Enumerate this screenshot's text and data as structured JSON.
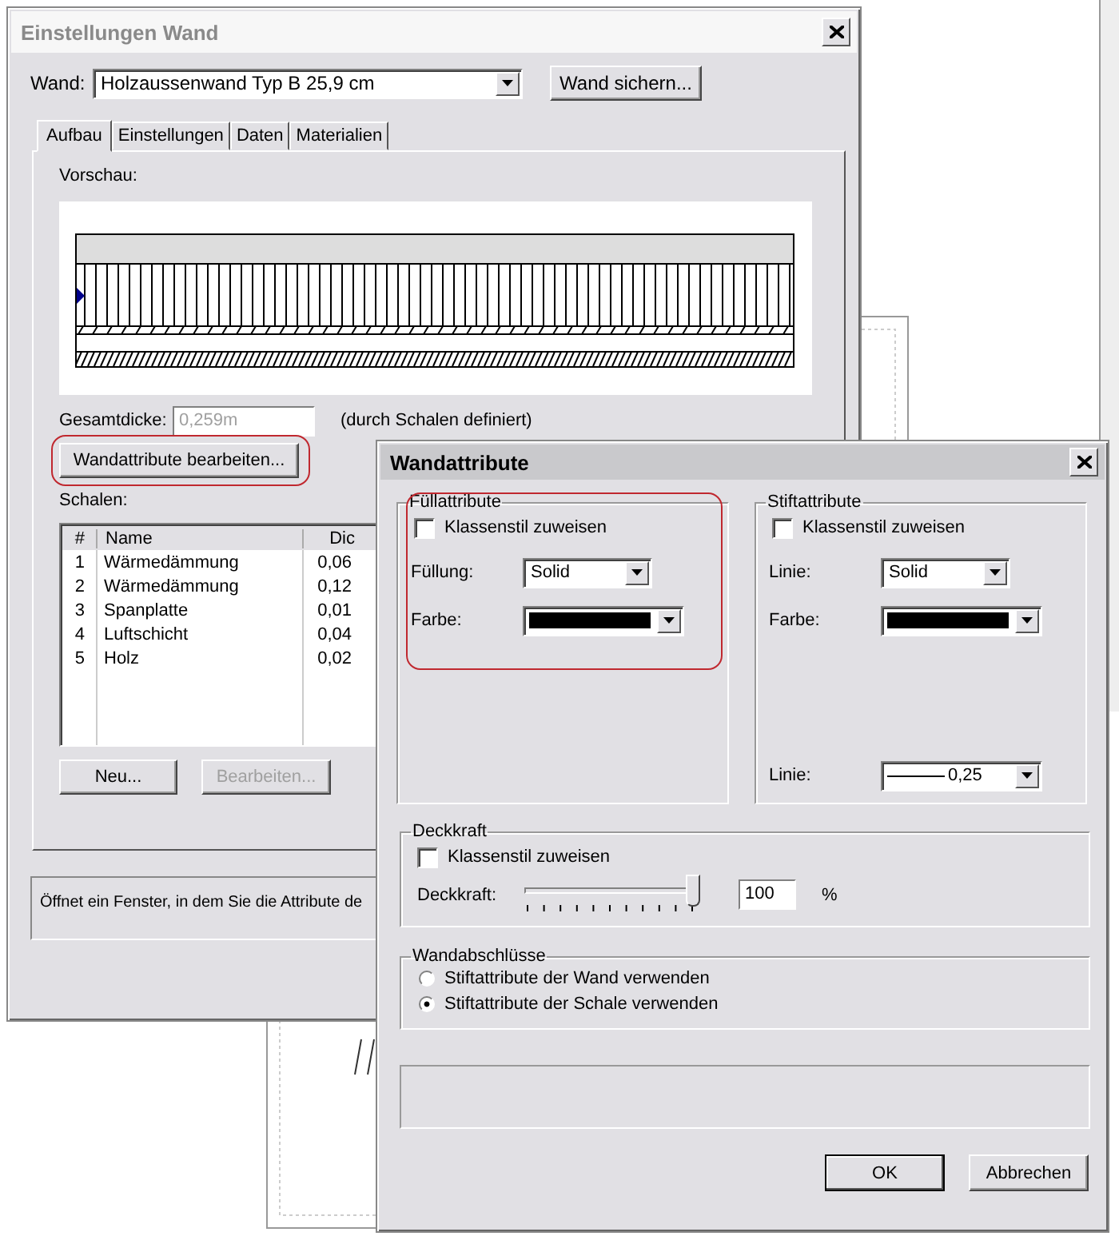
{
  "settings_window": {
    "title": "Einstellungen Wand",
    "active": false,
    "wall_label": "Wand:",
    "wall_value": "Holzaussenwand Typ B 25,9 cm",
    "save_button": "Wand sichern...",
    "tabs": [
      {
        "label": "Aufbau",
        "selected": true
      },
      {
        "label": "Einstellungen",
        "selected": false
      },
      {
        "label": "Daten",
        "selected": false
      },
      {
        "label": "Materialien",
        "selected": false
      }
    ],
    "preview_label": "Vorschau:",
    "thickness_label": "Gesamtdicke:",
    "thickness_value": "0,259m",
    "thickness_disabled": true,
    "thickness_note": "(durch Schalen definiert)",
    "edit_button": {
      "label": "Wandattribute bearbeiten...",
      "highlighted": true
    },
    "layers_label": "Schalen:",
    "layers": {
      "columns": [
        "#",
        "Name",
        "Dic"
      ],
      "rows": [
        [
          "1",
          "Wärmedämmung",
          "0,06"
        ],
        [
          "2",
          "Wärmedämmung",
          "0,12"
        ],
        [
          "3",
          "Spanplatte",
          "0,01"
        ],
        [
          "4",
          "Luftschicht",
          "0,04"
        ],
        [
          "5",
          "Holz",
          "0,02"
        ]
      ]
    },
    "buttons": [
      {
        "label": "Neu...",
        "disabled": false
      },
      {
        "label": "Bearbeiten...",
        "disabled": true
      }
    ],
    "status": "Öffnet ein Fenster, in dem Sie die Attribute de"
  },
  "attributes_window": {
    "title": "Wandattribute",
    "active": true,
    "groups": [
      {
        "title": "Füllattribute",
        "highlighted": true,
        "class_style": {
          "label": "Klassenstil zuweisen",
          "checked": false
        },
        "fields": [
          {
            "label": "Füllung:",
            "kind": "select",
            "value": "Solid"
          },
          {
            "label": "Farbe:",
            "kind": "color",
            "color": "#000000"
          }
        ]
      },
      {
        "title": "Stiftattribute",
        "highlighted": false,
        "class_style": {
          "label": "Klassenstil zuweisen",
          "checked": false
        },
        "fields": [
          {
            "label": "Linie:",
            "kind": "select",
            "value": "Solid"
          },
          {
            "label": "Farbe:",
            "kind": "color",
            "color": "#000000"
          },
          {
            "label": "Linie:",
            "kind": "line",
            "value": "0,25"
          }
        ]
      }
    ],
    "opacity": {
      "title": "Deckkraft",
      "class_style": {
        "label": "Klassenstil zuweisen",
        "checked": false
      },
      "label": "Deckkraft:",
      "level": 1,
      "value": "100",
      "unit": "%"
    },
    "ends": {
      "title": "Wandabschlüsse",
      "options": [
        {
          "label": "Stiftattribute der Wand verwenden",
          "selected": false
        },
        {
          "label": "Stiftattribute der Schale verwenden",
          "selected": true
        }
      ]
    },
    "buttons": [
      {
        "label": "OK",
        "default": true
      },
      {
        "label": "Abbrechen",
        "default": false
      }
    ]
  }
}
